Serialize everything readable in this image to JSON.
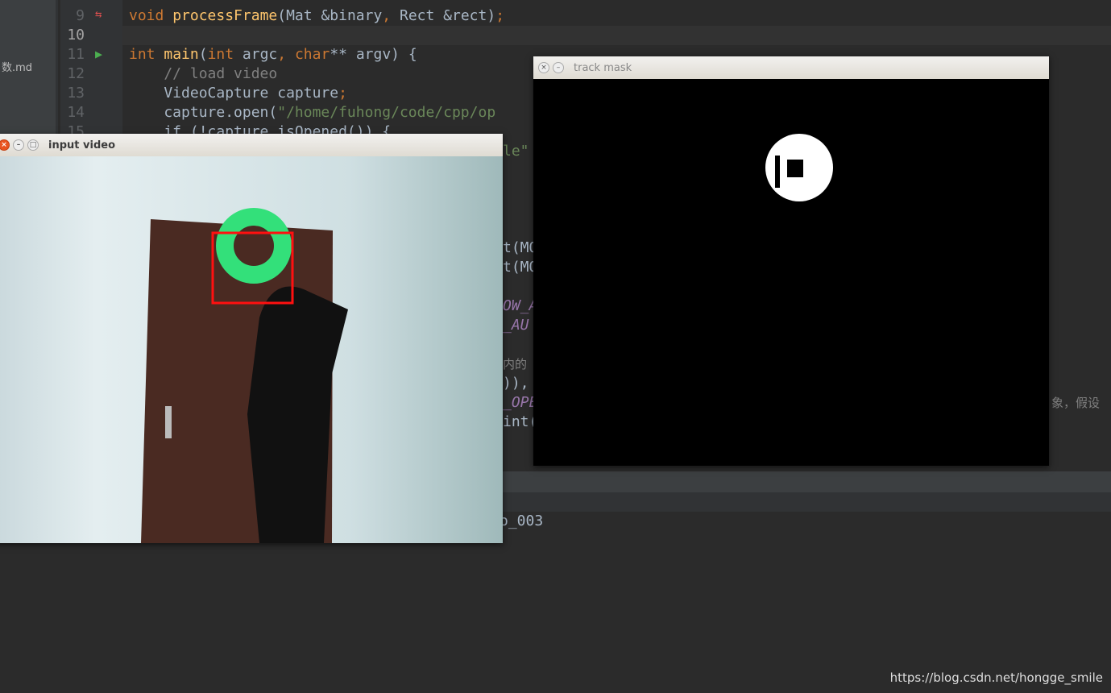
{
  "sidebar": {
    "file_fragment": "数.md"
  },
  "editor": {
    "line_numbers": [
      "9",
      "10",
      "11",
      "12",
      "13",
      "14",
      "15"
    ],
    "lines": {
      "l9": [
        "void",
        " processFrame",
        "(Mat &binary",
        ", ",
        "Rect &rect)",
        ";"
      ],
      "l11": [
        "int ",
        "main",
        "(",
        "int",
        " argc",
        ", ",
        "char",
        "** argv) {"
      ],
      "l12": "    // load video",
      "l13": [
        "    VideoCapture capture",
        ";"
      ],
      "l14": [
        "    capture.open(",
        "\"/home/fuhong/code/cpp/op",
        "                                                       )",
        ";"
      ],
      "l15": "    if (!capture.isOpened()) {"
    },
    "fragments": {
      "f16": "le\"",
      "f21": "t(MO",
      "f22": "t(MO",
      "f24": "OW_A",
      "f25": "_AU",
      "f27": "内的",
      "f28": ")),",
      "f29": "_OPE",
      "f30": "int(",
      "f29r": "象，假设"
    }
  },
  "output": {
    "text": "o_003"
  },
  "windows": {
    "input_video": {
      "title": "input video"
    },
    "track_mask": {
      "title": "track mask"
    }
  },
  "watermark": "https://blog.csdn.net/hongge_smile"
}
